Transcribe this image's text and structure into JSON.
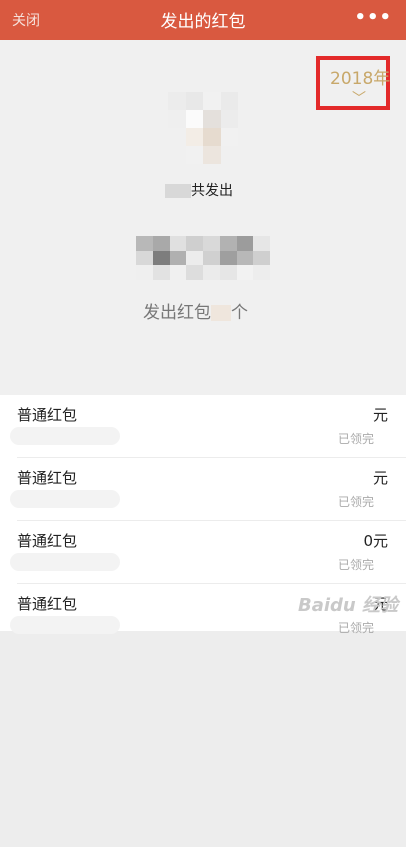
{
  "header": {
    "close_label": "关闭",
    "title": "发出的红包",
    "more_label": "•••"
  },
  "summary": {
    "year_label": "2018年",
    "chevron": "﹀",
    "total_suffix": "共发出",
    "count_prefix": "发出红包",
    "count_suffix": "个"
  },
  "list": {
    "items": [
      {
        "type_label": "普通红包",
        "amount_suffix": "元",
        "status": "已领完"
      },
      {
        "type_label": "普通红包",
        "amount_suffix": "元",
        "status": "已领完"
      },
      {
        "type_label": "普通红包",
        "amount_suffix": "0元",
        "status": "已领完"
      },
      {
        "type_label": "普通红包",
        "amount_suffix": "元",
        "status": "已领完"
      }
    ]
  },
  "watermark": "Baidu 经验",
  "colors": {
    "header_bg": "#d95940",
    "year_text": "#c8a86a",
    "highlight_box": "#e32a2a"
  }
}
